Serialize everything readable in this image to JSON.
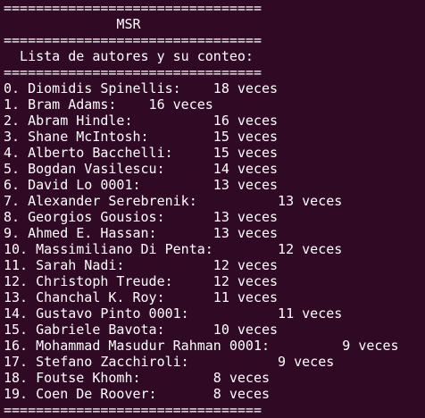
{
  "terminal": {
    "background_color": "#300a24",
    "text_color": "#ffffff",
    "lines": [
      "================================",
      "              MSR",
      "================================",
      "  Lista de autores y su conteo:",
      "================================",
      "0. Diomidis Spinellis:    18 veces",
      "1. Bram Adams:    16 veces",
      "2. Abram Hindle:          16 veces",
      "3. Shane McIntosh:        15 veces",
      "4. Alberto Bacchelli:     15 veces",
      "5. Bogdan Vasilescu:      14 veces",
      "6. David Lo 0001:         13 veces",
      "7. Alexander Serebrenik:          13 veces",
      "8. Georgios Gousios:      13 veces",
      "9. Ahmed E. Hassan:       13 veces",
      "10. Massimiliano Di Penta:        12 veces",
      "11. Sarah Nadi:           12 veces",
      "12. Christoph Treude:     12 veces",
      "13. Chanchal K. Roy:      11 veces",
      "14. Gustavo Pinto 0001:           11 veces",
      "15. Gabriele Bavota:      10 veces",
      "16. Mohammad Masudur Rahman 0001:         9 veces",
      "17. Stefano Zacchiroli:           9 veces",
      "18. Foutse Khomh:         8 veces",
      "19. Coen De Roover:       8 veces",
      "================================"
    ]
  }
}
